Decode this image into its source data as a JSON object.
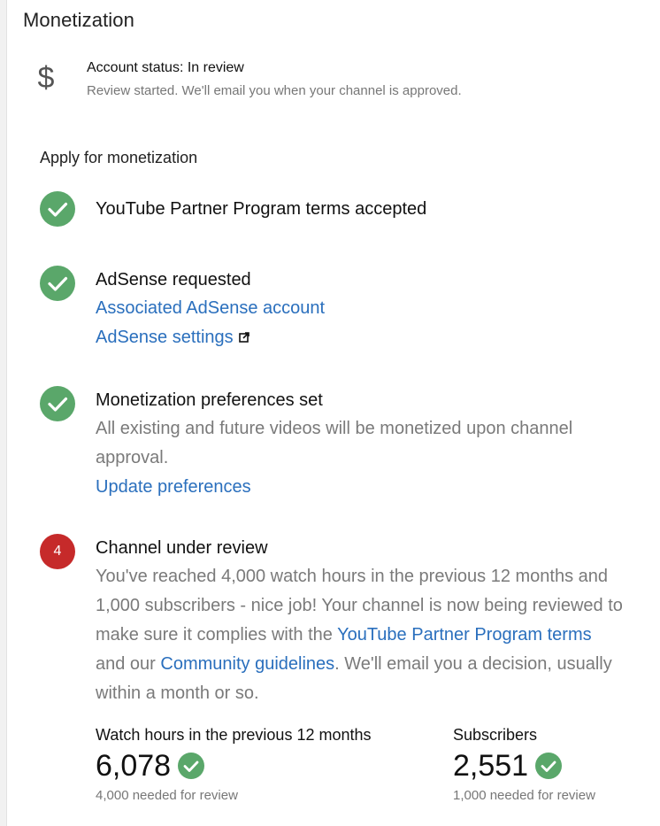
{
  "page": {
    "title": "Monetization"
  },
  "account_status": {
    "icon": "dollar-icon",
    "title": "Account status: In review",
    "subtitle": "Review started. We'll email you when your channel is approved."
  },
  "apply": {
    "heading": "Apply for monetization",
    "steps": [
      {
        "state": "done",
        "title": "YouTube Partner Program terms accepted"
      },
      {
        "state": "done",
        "title": "AdSense requested",
        "links": [
          "Associated AdSense account",
          "AdSense settings"
        ]
      },
      {
        "state": "done",
        "title": "Monetization preferences set",
        "text": "All existing and future videos will be monetized upon channel approval.",
        "link": "Update preferences"
      },
      {
        "state": "pending",
        "number": "4",
        "title": "Channel under review",
        "text_parts": [
          "You've reached 4,000 watch hours in the previous 12 months and 1,000 subscribers - nice job! Your channel is now being reviewed to make sure it complies with the ",
          "YouTube Partner Program terms",
          " and our ",
          "Community guidelines",
          ". We'll email you a decision, usually within a month or so."
        ]
      }
    ]
  },
  "stats": {
    "watch_hours": {
      "label": "Watch hours in the previous 12 months",
      "value": "6,078",
      "needed": "4,000 needed for review"
    },
    "subscribers": {
      "label": "Subscribers",
      "value": "2,551",
      "needed": "1,000 needed for review"
    }
  },
  "colors": {
    "success": "#5aa76a",
    "pending": "#c62a2a",
    "link": "#2a6fbd",
    "muted_text": "#7a7a7a"
  }
}
